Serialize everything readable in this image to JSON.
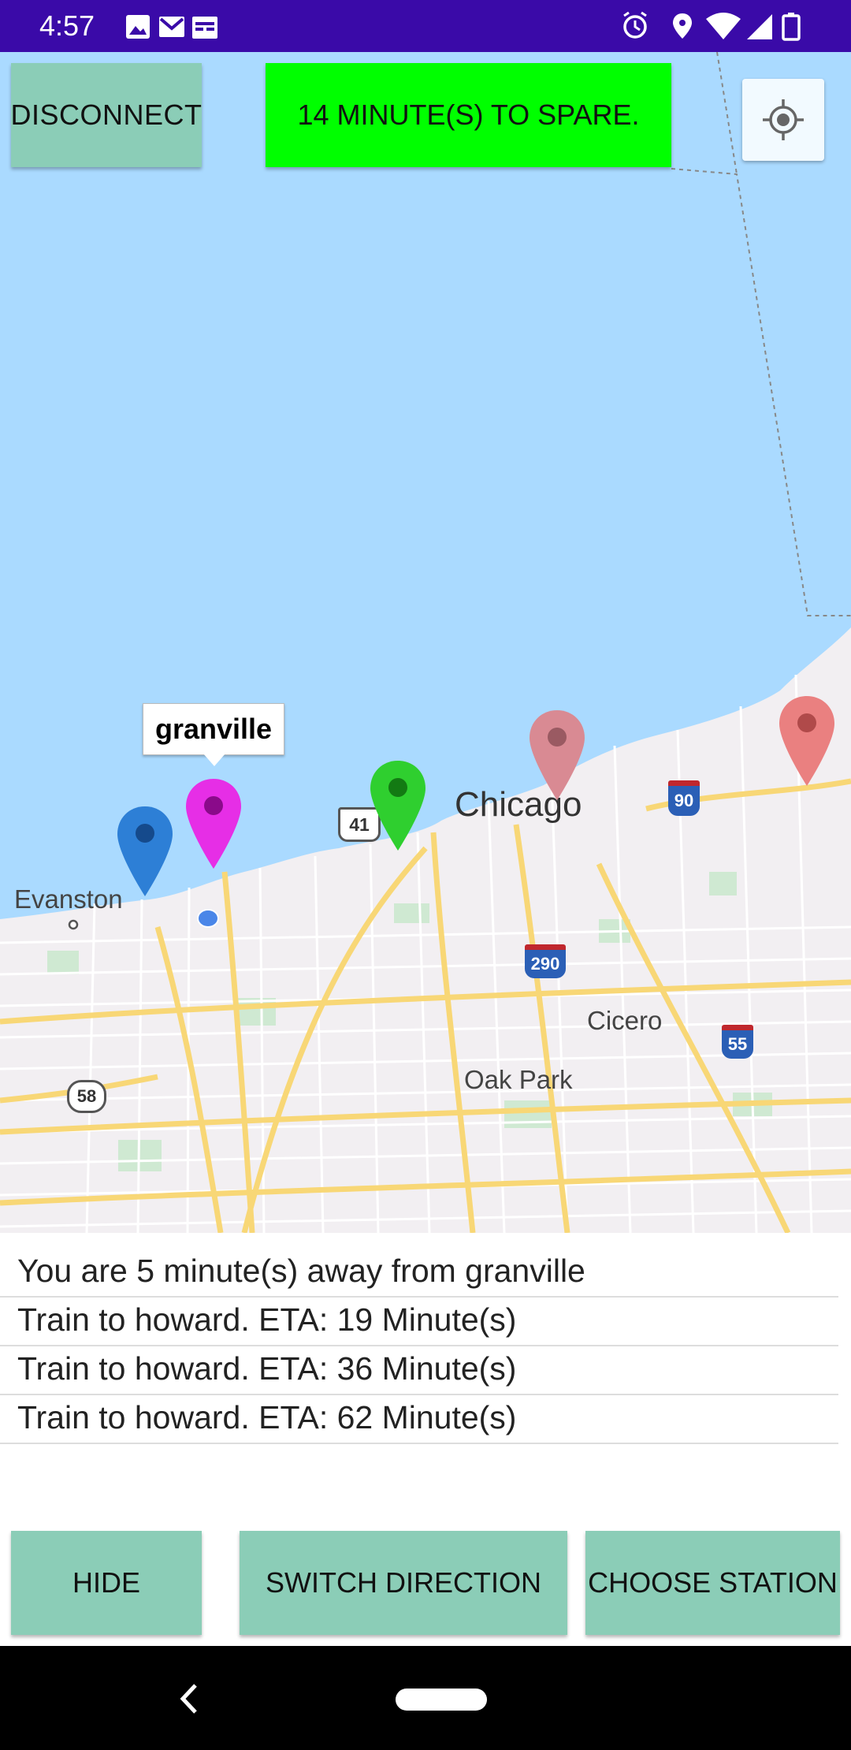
{
  "status_bar": {
    "time": "4:57",
    "left_icons": [
      "image-icon",
      "gmail-icon",
      "calendar-icon"
    ],
    "right_icons": [
      "alarm-icon",
      "location-icon",
      "wifi-icon",
      "signal-icon",
      "battery-icon"
    ],
    "background": "#3a0aa8"
  },
  "map": {
    "disconnect_label": "DISCONNECT",
    "spare_banner": "14 MINUTE(S) TO SPARE.",
    "info_window_title": "granville",
    "labels": {
      "chicago": "Chicago",
      "evanston": "Evanston",
      "cicero": "Cicero",
      "oak_park": "Oak Park"
    },
    "shields": {
      "us41": "41",
      "i90": "90",
      "i290": "290",
      "i55": "55",
      "r58": "58"
    },
    "markers": [
      {
        "name": "blue",
        "color": "#2d7fd6"
      },
      {
        "name": "granville",
        "color": "#e62ee6"
      },
      {
        "name": "green",
        "color": "#2fcf2f"
      },
      {
        "name": "rose-1",
        "color": "#d98a93"
      },
      {
        "name": "rose-2",
        "color": "#ea8080"
      }
    ],
    "water_color": "#aadaff",
    "land_color": "#f2eff2"
  },
  "info_list": {
    "rows": [
      "You are 5 minute(s) away from granville",
      "Train to howard. ETA: 19 Minute(s)",
      "Train to howard. ETA: 36 Minute(s)",
      "Train to howard. ETA: 62 Minute(s)"
    ]
  },
  "actions": {
    "hide_label": "HIDE",
    "switch_label": "SWITCH DIRECTION",
    "choose_label": "CHOOSE STATION",
    "button_color": "#8bcdb7",
    "banner_color": "#00ff00"
  }
}
